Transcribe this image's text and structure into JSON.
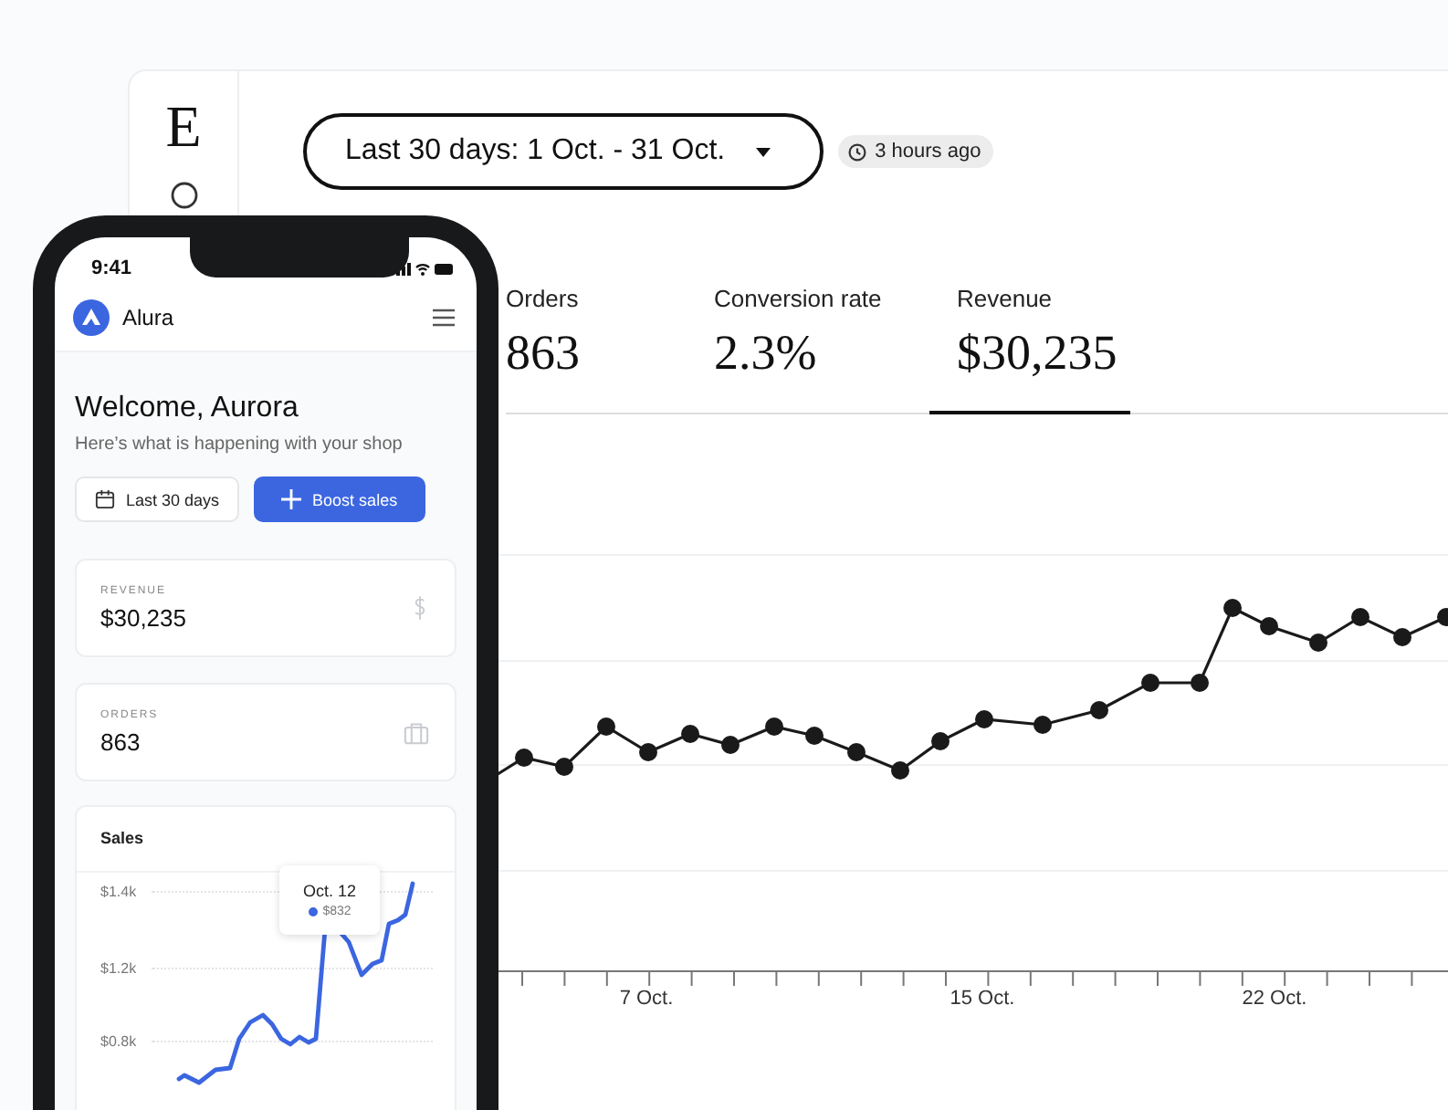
{
  "dashboard": {
    "logo": "E",
    "date_range": "Last 30 days: 1 Oct. - 31 Oct.",
    "updated": "3 hours ago",
    "metrics": [
      {
        "label": "Orders",
        "value": "863",
        "selected": false
      },
      {
        "label": "Conversion rate",
        "value": "2.3%",
        "selected": false
      },
      {
        "label": "Revenue",
        "value": "$30,235",
        "selected": true
      }
    ],
    "chart": {
      "x_labels": [
        "7 Oct.",
        "15 Oct.",
        "22 Oct."
      ]
    }
  },
  "phone": {
    "time": "9:41",
    "app_name": "Alura",
    "greeting": "Welcome, Aurora",
    "subtitle": "Here’s what is happening with your shop",
    "buttons": [
      {
        "label": "Last 30 days",
        "kind": "calendar"
      },
      {
        "label": "Boost sales",
        "kind": "primary"
      }
    ],
    "stat_cards": [
      {
        "label": "REVENUE",
        "value": "$30,235",
        "kind": "dollar"
      },
      {
        "label": "ORDERS",
        "value": "863",
        "kind": "bag"
      }
    ],
    "sales": {
      "title": "Sales",
      "tooltip": {
        "date": "Oct. 12",
        "value": "$832"
      },
      "y_labels": [
        "$1.4k",
        "$1.2k",
        "$0.8k"
      ]
    }
  }
}
